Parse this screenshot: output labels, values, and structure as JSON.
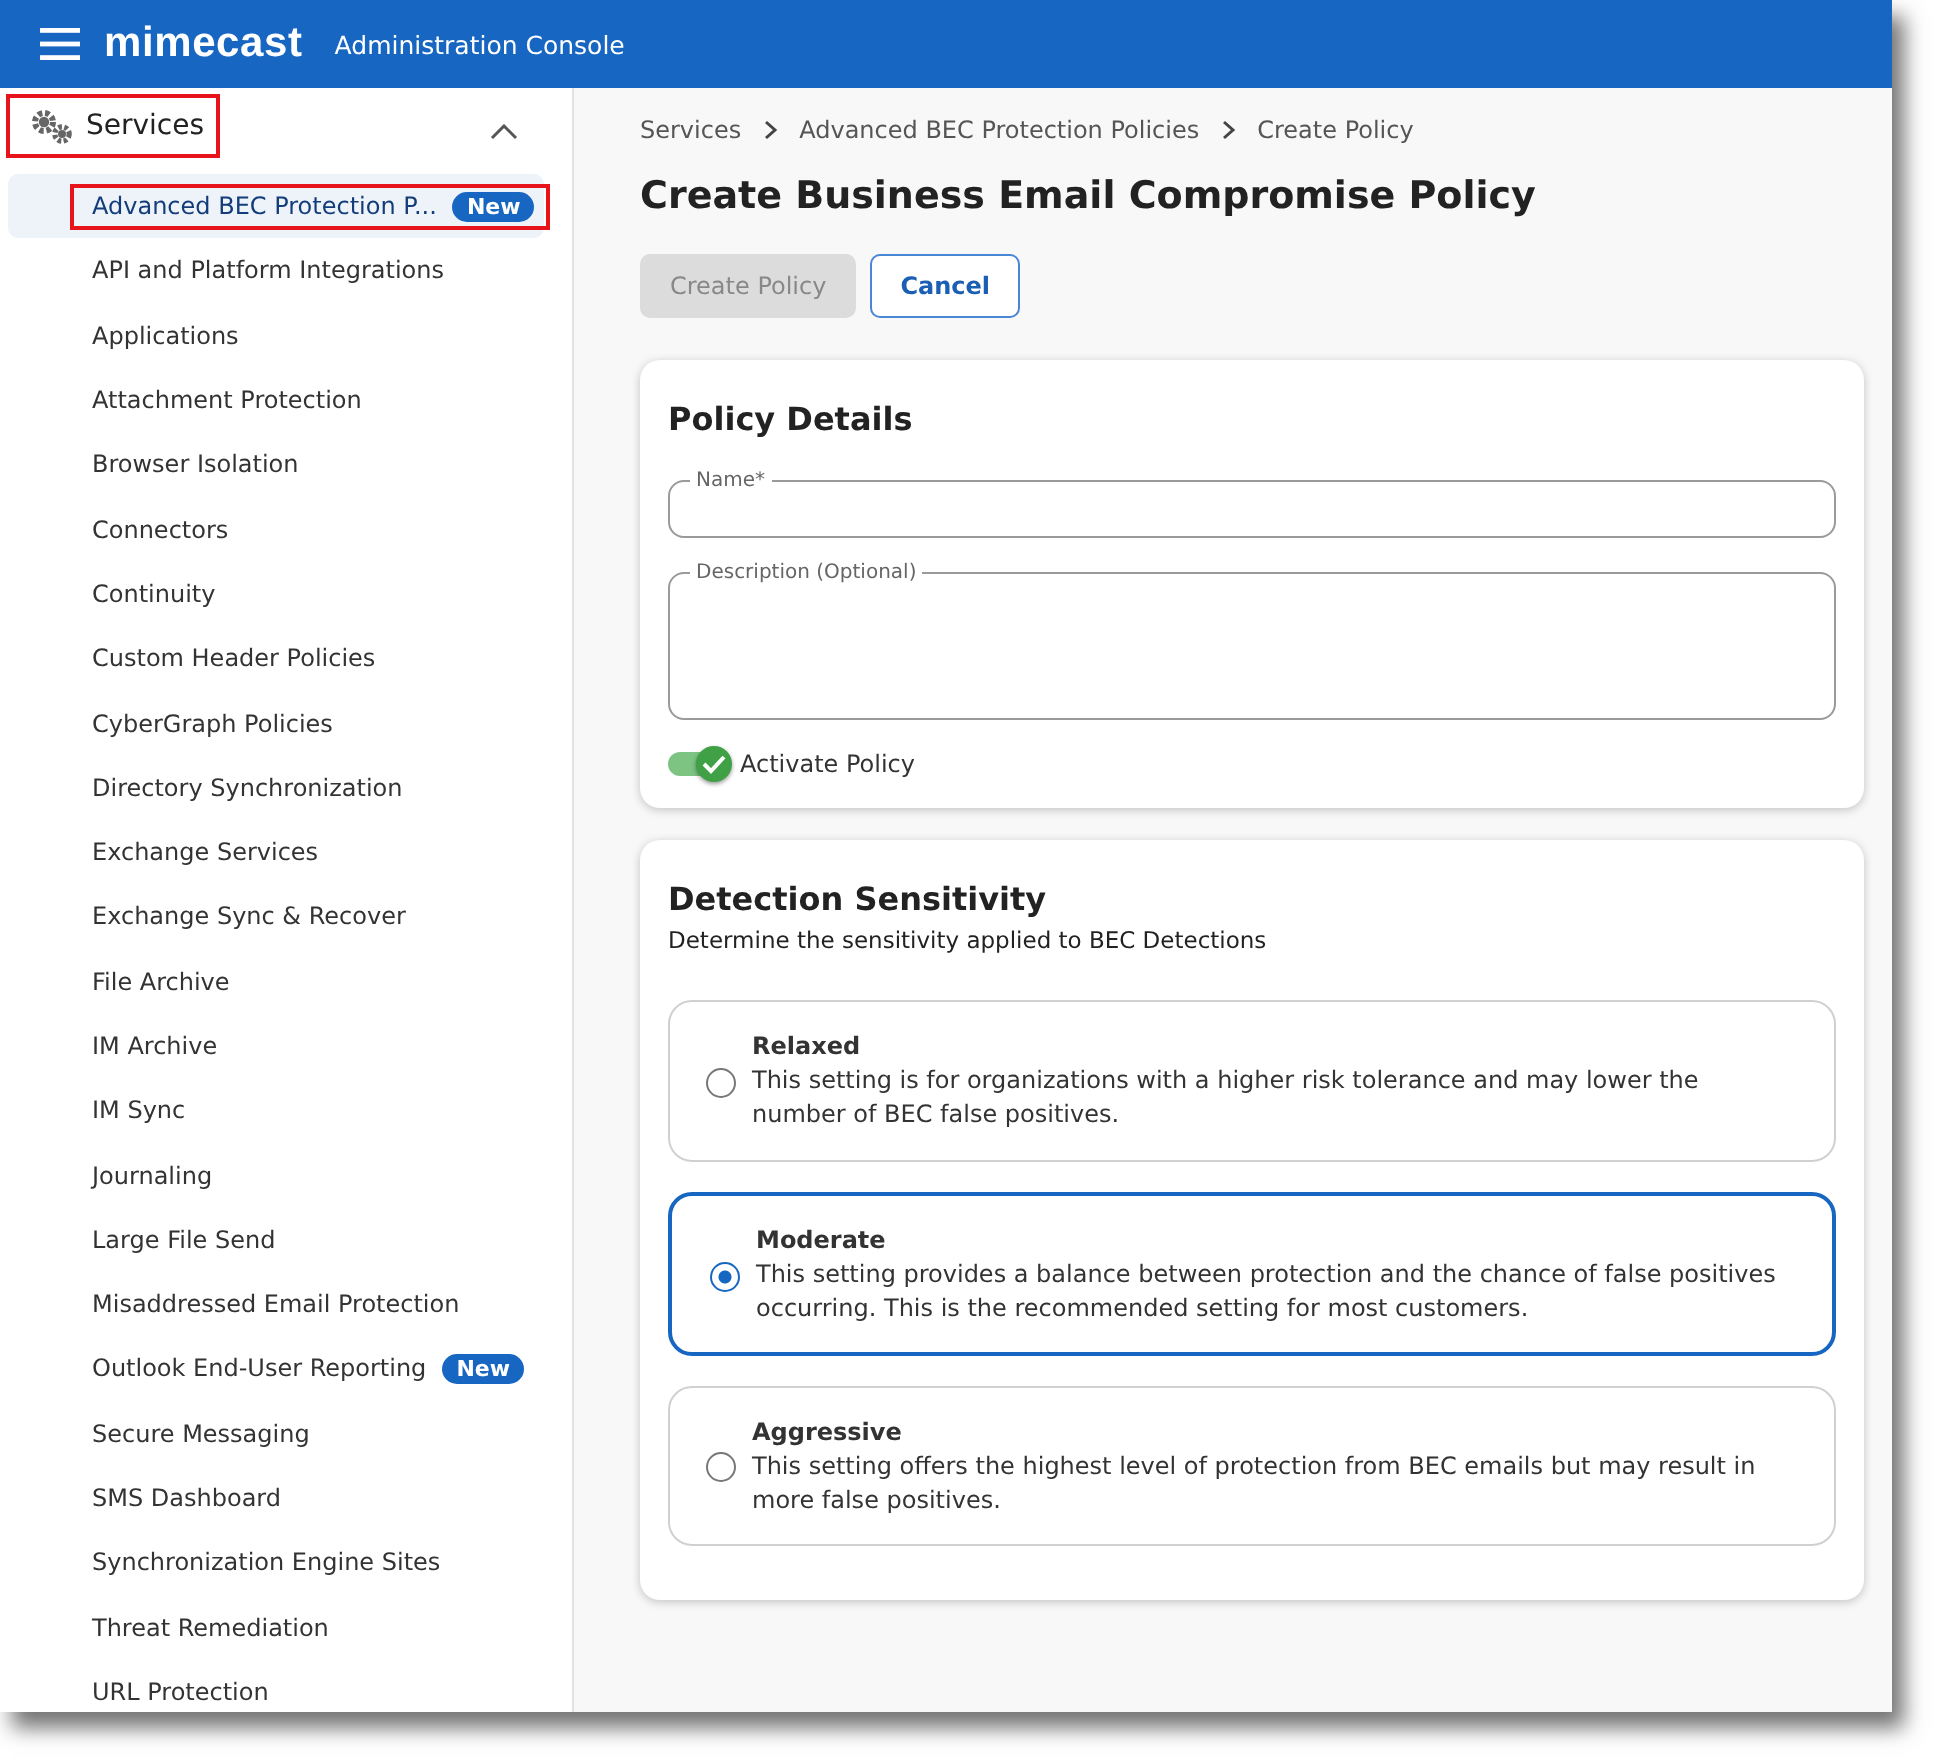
{
  "header": {
    "logo": "mimecast",
    "title": "Administration Console"
  },
  "sidebar": {
    "section": {
      "label": "Services",
      "expanded": true,
      "highlighted": true
    },
    "items": [
      {
        "label": "Advanced BEC Protection P...",
        "badge": "New",
        "selected": true,
        "highlighted": true
      },
      {
        "label": "API and Platform Integrations",
        "selected": false,
        "highlighted": false
      },
      {
        "label": "Applications",
        "selected": false,
        "highlighted": false
      },
      {
        "label": "Attachment Protection",
        "selected": false,
        "highlighted": false
      },
      {
        "label": "Browser Isolation",
        "selected": false,
        "highlighted": false
      },
      {
        "label": "Connectors",
        "selected": false,
        "highlighted": false
      },
      {
        "label": "Continuity",
        "selected": false,
        "highlighted": false
      },
      {
        "label": "Custom Header Policies",
        "selected": false,
        "highlighted": false
      },
      {
        "label": "CyberGraph Policies",
        "selected": false,
        "highlighted": false
      },
      {
        "label": "Directory Synchronization",
        "selected": false,
        "highlighted": false
      },
      {
        "label": "Exchange Services",
        "selected": false,
        "highlighted": false
      },
      {
        "label": "Exchange Sync & Recover",
        "selected": false,
        "highlighted": false
      },
      {
        "label": "File Archive",
        "selected": false,
        "highlighted": false
      },
      {
        "label": "IM Archive",
        "selected": false,
        "highlighted": false
      },
      {
        "label": "IM Sync",
        "selected": false,
        "highlighted": false
      },
      {
        "label": "Journaling",
        "selected": false,
        "highlighted": false
      },
      {
        "label": "Large File Send",
        "selected": false,
        "highlighted": false
      },
      {
        "label": "Misaddressed Email Protection",
        "selected": false,
        "highlighted": false
      },
      {
        "label": "Outlook End-User Reporting",
        "badge": "New",
        "selected": false,
        "highlighted": false
      },
      {
        "label": "Secure Messaging",
        "selected": false,
        "highlighted": false
      },
      {
        "label": "SMS Dashboard",
        "selected": false,
        "highlighted": false
      },
      {
        "label": "Synchronization Engine Sites",
        "selected": false,
        "highlighted": false
      },
      {
        "label": "Threat Remediation",
        "selected": false,
        "highlighted": false
      },
      {
        "label": "URL Protection",
        "selected": false,
        "highlighted": false
      }
    ]
  },
  "breadcrumb": [
    "Services",
    "Advanced BEC Protection Policies",
    "Create Policy"
  ],
  "page_title": "Create Business Email Compromise Policy",
  "buttons": [
    {
      "label": "Create Policy",
      "disabled": true
    },
    {
      "label": "Cancel",
      "disabled": false
    }
  ],
  "policy_details": {
    "title": "Policy Details",
    "name_field": {
      "label": "Name*"
    },
    "description_field": {
      "label": "Description (Optional)"
    },
    "activate": {
      "label": "Activate Policy",
      "on": true
    }
  },
  "detection": {
    "title": "Detection Sensitivity",
    "subtitle": "Determine the sensitivity applied to BEC Detections",
    "options": [
      {
        "title": "Relaxed",
        "text": "This setting is for organizations with a higher risk tolerance and may lower the number of BEC false positives.",
        "selected": false
      },
      {
        "title": "Moderate",
        "text": "This setting provides a balance between protection and the chance of false positives occurring. This is the recommended setting for most customers.",
        "selected": true
      },
      {
        "title": "Aggressive",
        "text": "This setting offers the highest level of protection from BEC emails but may result in more false positives.",
        "selected": false
      }
    ]
  }
}
